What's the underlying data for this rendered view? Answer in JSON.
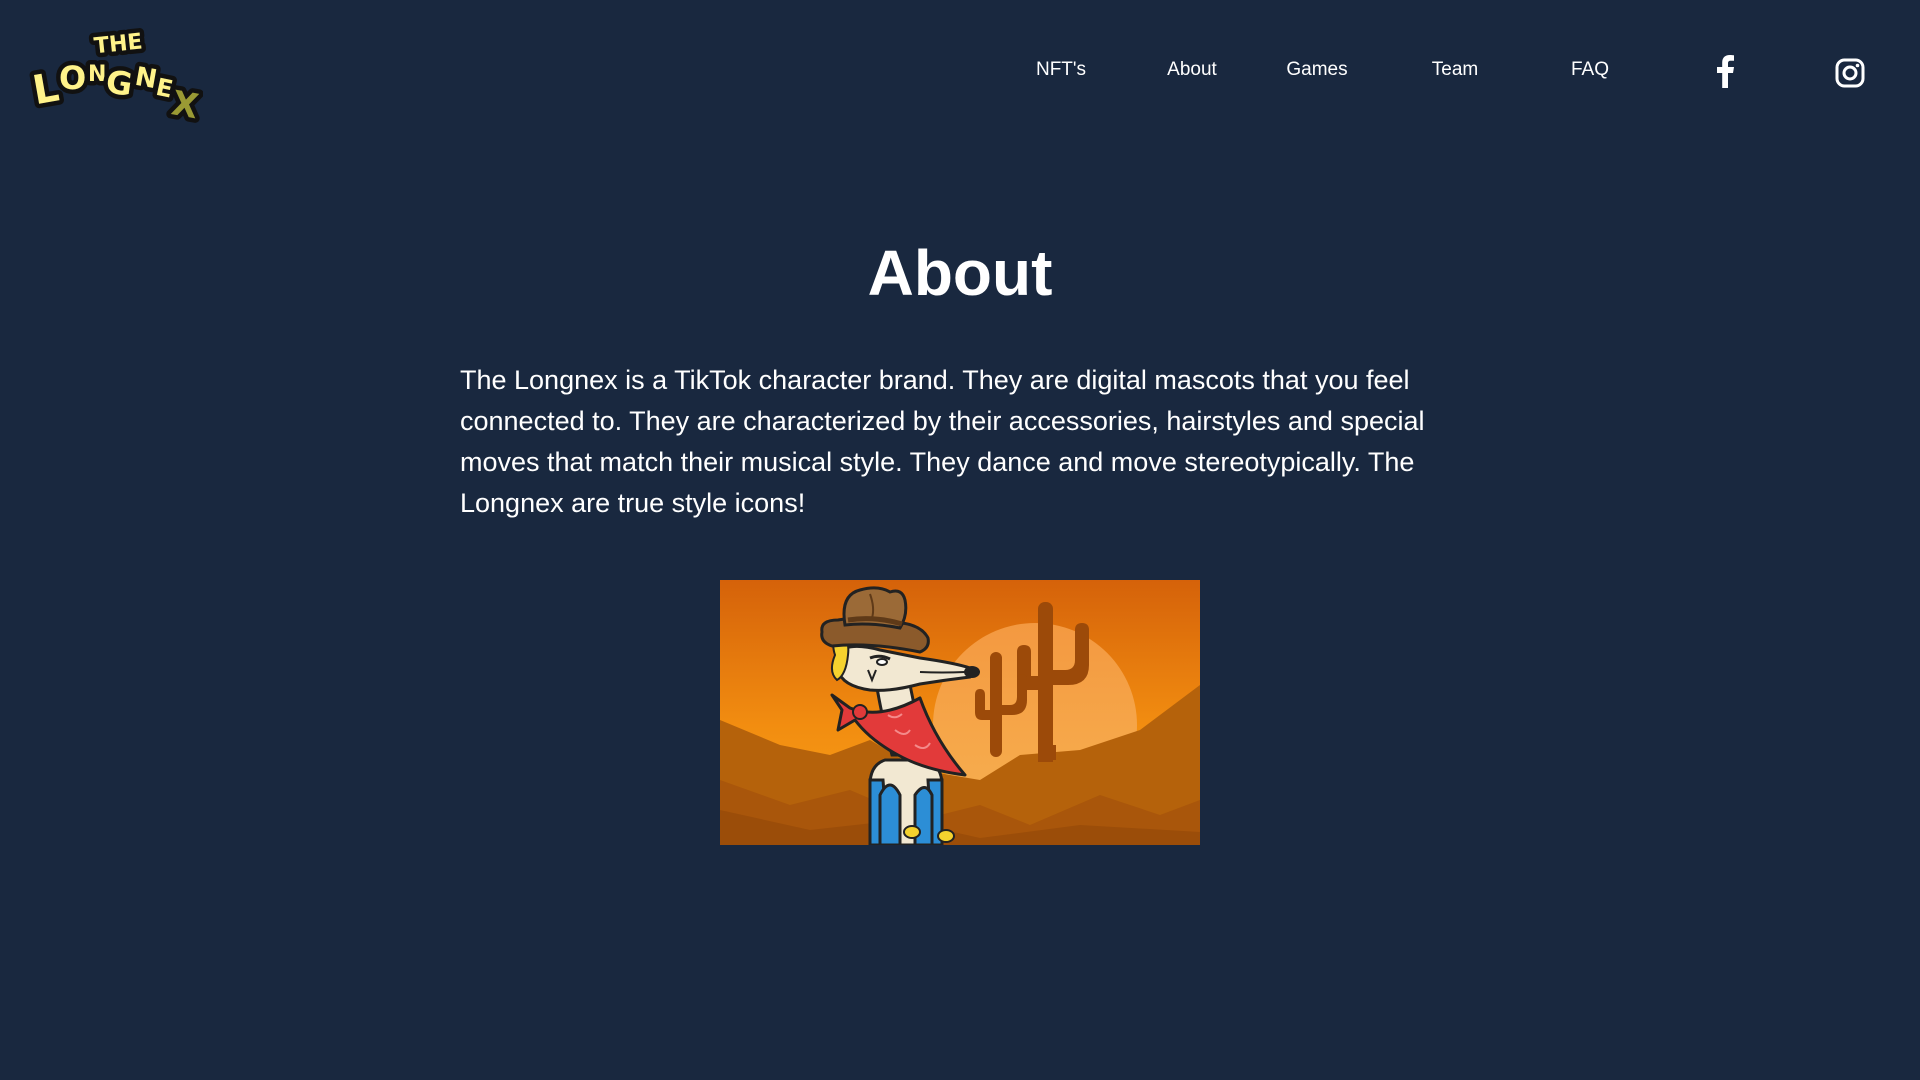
{
  "logo": {
    "word_top": "THE",
    "word_main": "LONGNEX",
    "icon": "longnex-logo"
  },
  "nav": {
    "items": [
      {
        "label": "NFT's"
      },
      {
        "label": "About"
      },
      {
        "label": "Games"
      },
      {
        "label": "Team"
      },
      {
        "label": "FAQ"
      }
    ],
    "social": [
      {
        "icon": "facebook-icon"
      },
      {
        "icon": "instagram-icon"
      }
    ]
  },
  "about": {
    "title": "About",
    "description": "The Longnex is a TikTok character brand. They are digital mascots that you feel connected to. They are characterized by their accessories, hairstyles and special moves that match their musical style. They dance and move stereotypically. The Longnex are true style icons!"
  },
  "hero_image": {
    "subject": "cowboy-longnex-desert-illustration"
  },
  "colors": {
    "background": "#19283f",
    "text": "#ffffff",
    "logo_yellow": "#fff38a",
    "sky_top": "#d86a0a",
    "sky_bottom": "#f79a1a"
  }
}
